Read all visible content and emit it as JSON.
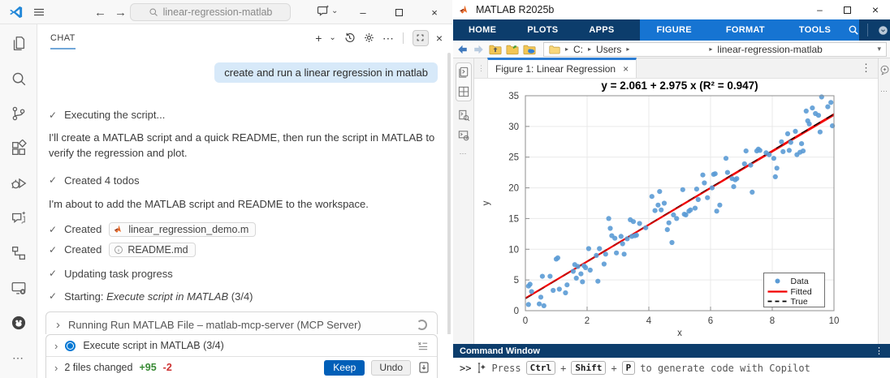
{
  "icons": {
    "check": "✓",
    "chevron_right": "›",
    "dots_vertical": "⋮",
    "dots_horizontal": "⋯",
    "close": "×",
    "minimize": "–",
    "plus": "+",
    "chevron_down": "⌄",
    "back_arrow": "←",
    "forward_arrow": "→",
    "dropdown_arrow": "▾",
    "breadcrumb_sep": "▸"
  },
  "vscode": {
    "titlebar": {
      "search_value": "linear-regression-matlab"
    },
    "activity_bar_icons": [
      "explorer",
      "search",
      "source-control",
      "extensions",
      "run-debug",
      "copilot-chat",
      "references",
      "remote-explorer",
      "github",
      "more"
    ],
    "chat": {
      "tab_label": "CHAT",
      "user_message": "create and run a linear regression in matlab",
      "executing": "Executing the script...",
      "intro": "I'll create a MATLAB script and a quick README, then run the script in MATLAB to verify the regression and plot.",
      "created_todos": "Created 4 todos",
      "about": "I'm about to add the MATLAB script and README to the workspace.",
      "created_label": "Created",
      "file1": "linear_regression_demo.m",
      "file2": "README.md",
      "updating": "Updating task progress",
      "starting_prefix": "Starting:",
      "starting_task": "Execute script in MATLAB",
      "starting_count": "(3/4)",
      "running_label": "Running Run MATLAB File – matlab-mcp-server (MCP Server)",
      "todo_label": "Execute script in MATLAB (3/4)",
      "files_changed": "2 files changed",
      "additions": "+95",
      "deletions": "-2",
      "keep": "Keep",
      "undo": "Undo"
    }
  },
  "matlab": {
    "title": "MATLAB R2025b",
    "toolstrip": {
      "main": [
        "HOME",
        "PLOTS",
        "APPS"
      ],
      "context": [
        "FIGURE",
        "FORMAT",
        "TOOLS"
      ]
    },
    "addressbar": {
      "items": [
        "C:",
        "Users",
        "linear-regression-matlab"
      ]
    },
    "figure_tab_label": "Figure 1: Linear Regression",
    "command_window": {
      "header": "Command Window",
      "prompt": ">>",
      "hint_press": "Press",
      "keys": [
        "Ctrl",
        "Shift",
        "P"
      ],
      "key_join": "+",
      "hint_rest": "to generate code with Copilot"
    }
  },
  "chart_data": {
    "type": "scatter",
    "title": "y = 2.061 + 2.975 x   (R² = 0.947)",
    "xlabel": "x",
    "ylabel": "y",
    "xlim": [
      0,
      10
    ],
    "ylim": [
      0,
      35
    ],
    "xticks": [
      0,
      2,
      4,
      6,
      8,
      10
    ],
    "yticks": [
      0,
      5,
      10,
      15,
      20,
      25,
      30,
      35
    ],
    "grid": true,
    "legend": {
      "position": "southeast",
      "entries": [
        "Data",
        "Fitted",
        "True"
      ]
    },
    "series": [
      {
        "name": "Data",
        "type": "scatter",
        "color": "#5b9bd5",
        "points": [
          [
            0.1,
            1.0
          ],
          [
            0.1,
            4.0
          ],
          [
            0.15,
            4.3
          ],
          [
            0.2,
            3.1
          ],
          [
            0.45,
            1.1
          ],
          [
            0.5,
            2.2
          ],
          [
            0.55,
            5.6
          ],
          [
            0.6,
            0.8
          ],
          [
            0.8,
            5.6
          ],
          [
            0.9,
            3.3
          ],
          [
            1.0,
            8.4
          ],
          [
            1.05,
            8.6
          ],
          [
            1.1,
            3.5
          ],
          [
            1.3,
            2.9
          ],
          [
            1.35,
            4.2
          ],
          [
            1.55,
            6.4
          ],
          [
            1.6,
            7.5
          ],
          [
            1.65,
            5.3
          ],
          [
            1.7,
            7.2
          ],
          [
            1.8,
            6.0
          ],
          [
            1.85,
            4.7
          ],
          [
            1.9,
            7.3
          ],
          [
            1.95,
            7.0
          ],
          [
            2.05,
            10.1
          ],
          [
            2.1,
            6.6
          ],
          [
            2.3,
            9.0
          ],
          [
            2.35,
            4.8
          ],
          [
            2.4,
            10.1
          ],
          [
            2.55,
            7.6
          ],
          [
            2.6,
            9.2
          ],
          [
            2.7,
            15.0
          ],
          [
            2.75,
            13.4
          ],
          [
            2.8,
            12.2
          ],
          [
            2.9,
            11.8
          ],
          [
            2.95,
            9.4
          ],
          [
            3.1,
            12.1
          ],
          [
            3.15,
            10.9
          ],
          [
            3.2,
            9.2
          ],
          [
            3.3,
            11.7
          ],
          [
            3.4,
            14.8
          ],
          [
            3.45,
            12.1
          ],
          [
            3.5,
            14.5
          ],
          [
            3.55,
            12.2
          ],
          [
            3.6,
            12.3
          ],
          [
            3.7,
            14.2
          ],
          [
            3.9,
            13.5
          ],
          [
            4.1,
            18.6
          ],
          [
            4.2,
            16.3
          ],
          [
            4.3,
            17.2
          ],
          [
            4.35,
            19.4
          ],
          [
            4.4,
            16.4
          ],
          [
            4.5,
            17.5
          ],
          [
            4.6,
            13.2
          ],
          [
            4.65,
            14.3
          ],
          [
            4.75,
            11.1
          ],
          [
            4.8,
            15.6
          ],
          [
            4.9,
            15.0
          ],
          [
            5.1,
            19.7
          ],
          [
            5.15,
            15.7
          ],
          [
            5.2,
            15.6
          ],
          [
            5.3,
            16.2
          ],
          [
            5.35,
            16.4
          ],
          [
            5.5,
            16.7
          ],
          [
            5.55,
            19.8
          ],
          [
            5.6,
            18.1
          ],
          [
            5.75,
            22.1
          ],
          [
            5.8,
            20.8
          ],
          [
            5.9,
            18.4
          ],
          [
            6.05,
            20.0
          ],
          [
            6.1,
            22.2
          ],
          [
            6.15,
            22.3
          ],
          [
            6.2,
            16.2
          ],
          [
            6.3,
            17.2
          ],
          [
            6.5,
            24.8
          ],
          [
            6.55,
            22.5
          ],
          [
            6.7,
            21.5
          ],
          [
            6.75,
            20.2
          ],
          [
            6.8,
            21.3
          ],
          [
            6.85,
            21.5
          ],
          [
            7.1,
            23.9
          ],
          [
            7.15,
            26.0
          ],
          [
            7.3,
            23.7
          ],
          [
            7.35,
            19.3
          ],
          [
            7.5,
            26.0
          ],
          [
            7.55,
            26.3
          ],
          [
            7.6,
            26.1
          ],
          [
            7.8,
            25.7
          ],
          [
            7.9,
            25.4
          ],
          [
            8.05,
            24.8
          ],
          [
            8.1,
            21.8
          ],
          [
            8.15,
            23.2
          ],
          [
            8.3,
            27.5
          ],
          [
            8.35,
            25.9
          ],
          [
            8.5,
            28.8
          ],
          [
            8.55,
            26.1
          ],
          [
            8.6,
            27.4
          ],
          [
            8.75,
            29.2
          ],
          [
            8.8,
            25.4
          ],
          [
            8.9,
            25.8
          ],
          [
            8.95,
            27.2
          ],
          [
            9.0,
            26.0
          ],
          [
            9.1,
            32.5
          ],
          [
            9.15,
            30.9
          ],
          [
            9.2,
            30.4
          ],
          [
            9.3,
            33.0
          ],
          [
            9.4,
            32.1
          ],
          [
            9.5,
            31.8
          ],
          [
            9.55,
            29.1
          ],
          [
            9.6,
            34.8
          ],
          [
            9.8,
            33.2
          ],
          [
            9.9,
            33.9
          ],
          [
            9.95,
            30.1
          ]
        ]
      },
      {
        "name": "Fitted",
        "type": "line",
        "color": "#f20000",
        "intercept": 2.061,
        "slope": 2.975
      },
      {
        "name": "True",
        "type": "line",
        "dash": true,
        "color": "#000000",
        "intercept": 2.0,
        "slope": 3.0
      }
    ]
  }
}
